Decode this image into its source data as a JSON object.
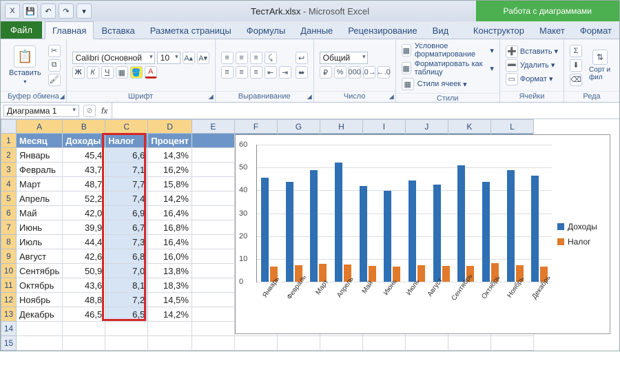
{
  "title": {
    "filename": "ТестArk.xlsx",
    "app": "Microsoft Excel",
    "chart_tools": "Работа с диаграммами"
  },
  "qat": {
    "save": "save",
    "undo": "undo",
    "redo": "redo"
  },
  "tabs": {
    "file": "Файл",
    "list": [
      "Главная",
      "Вставка",
      "Разметка страницы",
      "Формулы",
      "Данные",
      "Рецензирование",
      "Вид"
    ],
    "chart": [
      "Конструктор",
      "Макет",
      "Формат"
    ],
    "active": "Главная"
  },
  "ribbon": {
    "clipboard": {
      "paste": "Вставить",
      "label": "Буфер обмена"
    },
    "font": {
      "name": "Calibri (Основной",
      "size": "10",
      "bold": "Ж",
      "italic": "К",
      "underline": "Ч",
      "label": "Шрифт"
    },
    "align": {
      "label": "Выравнивание"
    },
    "number": {
      "format": "Общий",
      "label": "Число"
    },
    "styles": {
      "cond": "Условное форматирование",
      "table": "Форматировать как таблицу",
      "cell": "Стили ячеек",
      "label": "Стили"
    },
    "cells": {
      "insert": "Вставить",
      "delete": "Удалить",
      "format": "Формат",
      "label": "Ячейки"
    },
    "editing": {
      "sort": "Сорт и фил",
      "label": "Реда"
    }
  },
  "fbar": {
    "name": "Диаграмма 1",
    "fx": "fx"
  },
  "sheet": {
    "cols": [
      "A",
      "B",
      "C",
      "D",
      "E",
      "F",
      "G",
      "H",
      "I",
      "J",
      "K",
      "L"
    ],
    "headers": [
      "Месяц",
      "Доходы",
      "Налог",
      "Процент"
    ],
    "rows": [
      {
        "m": "Январь",
        "d": "45,4",
        "n": "6,6",
        "p": "14,3%"
      },
      {
        "m": "Февраль",
        "d": "43,7",
        "n": "7,1",
        "p": "16,2%"
      },
      {
        "m": "Март",
        "d": "48,7",
        "n": "7,7",
        "p": "15,8%"
      },
      {
        "m": "Апрель",
        "d": "52,2",
        "n": "7,4",
        "p": "14,2%"
      },
      {
        "m": "Май",
        "d": "42,0",
        "n": "6,9",
        "p": "16,4%"
      },
      {
        "m": "Июнь",
        "d": "39,9",
        "n": "6,7",
        "p": "16,8%"
      },
      {
        "m": "Июль",
        "d": "44,4",
        "n": "7,3",
        "p": "16,4%"
      },
      {
        "m": "Август",
        "d": "42,6",
        "n": "6,8",
        "p": "16,0%"
      },
      {
        "m": "Сентябрь",
        "d": "50,9",
        "n": "7,0",
        "p": "13,8%"
      },
      {
        "m": "Октябрь",
        "d": "43,6",
        "n": "8,1",
        "p": "18,3%"
      },
      {
        "m": "Ноябрь",
        "d": "48,8",
        "n": "7,2",
        "p": "14,5%"
      },
      {
        "m": "Декабрь",
        "d": "46,5",
        "n": "6,5",
        "p": "14,2%"
      }
    ],
    "blank_rows": [
      "14",
      "15"
    ]
  },
  "chart_data": {
    "type": "bar",
    "categories": [
      "Январь",
      "Февраль",
      "Март",
      "Апрель",
      "Май",
      "Июнь",
      "Июль",
      "Август",
      "Сентябрь",
      "Октябрь",
      "Ноябрь",
      "Декабрь"
    ],
    "series": [
      {
        "name": "Доходы",
        "values": [
          45.4,
          43.7,
          48.7,
          52.2,
          42.0,
          39.9,
          44.4,
          42.6,
          50.9,
          43.6,
          48.8,
          46.5
        ],
        "color": "#2f6fb3"
      },
      {
        "name": "Налог",
        "values": [
          6.6,
          7.1,
          7.7,
          7.4,
          6.9,
          6.7,
          7.3,
          6.8,
          7.0,
          8.1,
          7.2,
          6.5
        ],
        "color": "#e27a2b"
      }
    ],
    "ylim": [
      0,
      60
    ],
    "yticks": [
      0,
      10,
      20,
      30,
      40,
      50,
      60
    ],
    "title": "",
    "xlabel": "",
    "ylabel": ""
  }
}
